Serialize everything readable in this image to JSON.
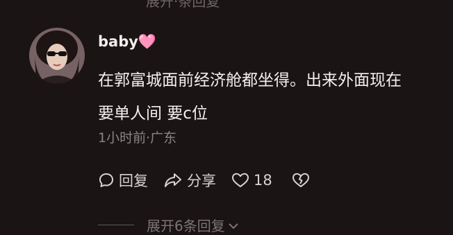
{
  "top_expand_text": "展开·条回复",
  "comment": {
    "username": "baby🩷",
    "content_lines": [
      "在郭富城面前经济舱都坐得。出来外面现在",
      "要单人间 要c位"
    ],
    "meta": "1小时前·广东",
    "actions": {
      "reply_label": "回复",
      "share_label": "分享",
      "like_count": "18"
    },
    "expand_label": "展开6条回复"
  },
  "icons": [
    "comment-bubble-icon",
    "share-arrow-icon",
    "heart-icon",
    "broken-heart-icon",
    "chevron-down-icon"
  ],
  "colors": {
    "background": "#1a1414",
    "text": "#f4f0f0",
    "muted": "#8c8585"
  }
}
